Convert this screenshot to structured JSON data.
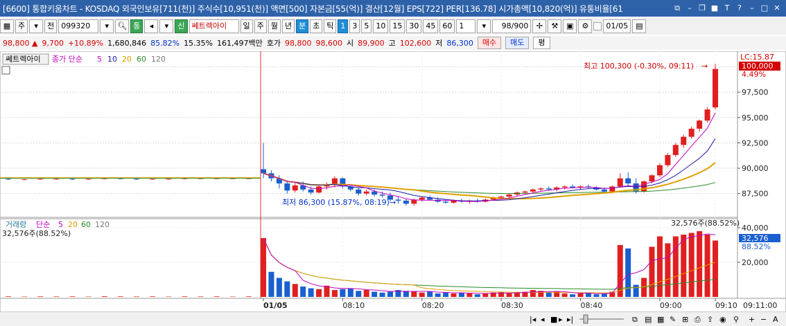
{
  "titlebar": {
    "text": "[6600] 통합키움차트 - KOSDAQ 외국인보유[711(천)] 주식수[10,951(천)] 액면[500] 자본금[55(억)] 결산[12월] EPS[722] PER[136.78] 시가총액[10,820(억)] 유통비율[61",
    "buttons": [
      "⧉",
      "–",
      "❐",
      "■",
      "T",
      "?",
      "–",
      "□",
      "✕"
    ]
  },
  "toolbar": {
    "market_label": "주",
    "all_label": "전",
    "code": "099320",
    "stock_name": "쎄트렉아이",
    "shin_label": "신",
    "periods": [
      "일",
      "주",
      "월",
      "년",
      "분",
      "초",
      "틱"
    ],
    "selected_period": "분",
    "intervals": [
      "1",
      "3",
      "5",
      "10",
      "15",
      "30",
      "45",
      "60"
    ],
    "selected_interval": "1",
    "multiplier": "1",
    "count": "98/900",
    "date": "01/05",
    "tong_label": "통"
  },
  "quote": {
    "price": "98,800 ▲",
    "change": "9,700",
    "change_pct": "+10.89%",
    "volume": "1,680,846",
    "vol_ratio": "85.82%",
    "turnover": "15.35%",
    "amount": "161,497백만",
    "hoga_label": "호가",
    "ask": "98,800",
    "bid": "98,600",
    "open_label": "시",
    "open": "89,900",
    "high_label": "고",
    "high": "102,600",
    "low_label": "저",
    "low": "86,300",
    "buy_label": "매수",
    "sell_label": "매도",
    "pyeong_label": "평"
  },
  "price_panel": {
    "stock_label": "쎄트렉아이",
    "ma_title": "종가 단순",
    "ma_periods": [
      "5",
      "10",
      "20",
      "60",
      "120"
    ],
    "ma_colors": [
      "#c000c0",
      "#1a1aa0",
      "#e0a000",
      "#2a8a2a",
      "#777777"
    ],
    "high_annotation": "최고 100,300 (-0.30%, 09:11)",
    "low_annotation": "최저 86,300 (15.87%, 08:19)",
    "lc_label": "LC:15.87",
    "current_price_label": "100,000",
    "current_pct_label": "4.49%"
  },
  "volume_panel": {
    "title": "거래량",
    "ma_title": "단순",
    "ma_periods": [
      "5",
      "20",
      "60",
      "120"
    ],
    "ma_colors": [
      "#c000c0",
      "#e0a000",
      "#2a8a2a",
      "#777777"
    ],
    "cursor_readout": "32,576주(88.52%)",
    "right_readout": "32,576주(88.52%)",
    "current_label": "32,576",
    "current_pct": "88.52%"
  },
  "footer": {
    "time_label": "09:11:00"
  },
  "chart_data": [
    {
      "type": "candlestick",
      "title": "쎄트렉아이 1분봉",
      "x_labels": [
        "01/05",
        "08:10",
        "08:20",
        "08:30",
        "08:40",
        "09:00",
        "09:10"
      ],
      "y_ticks": [
        87500,
        90000,
        92500,
        95000,
        97500,
        100000
      ],
      "ylim": [
        85700,
        101000
      ],
      "prev_day": [
        [
          88950,
          89000,
          88850,
          88900
        ],
        [
          88900,
          88950,
          88850,
          88900
        ],
        [
          88900,
          88950,
          88850,
          88950
        ],
        [
          88950,
          89000,
          88900,
          88950
        ],
        [
          88950,
          89000,
          88850,
          88900
        ],
        [
          88900,
          88950,
          88850,
          88950
        ],
        [
          88950,
          89050,
          88900,
          89000
        ],
        [
          89000,
          89050,
          88900,
          88950
        ],
        [
          88950,
          89000,
          88850,
          88900
        ],
        [
          88900,
          88950,
          88850,
          88950
        ],
        [
          88950,
          89000,
          88900,
          88950
        ],
        [
          88950,
          89050,
          88900,
          89000
        ],
        [
          89000,
          89050,
          88950,
          89000
        ],
        [
          89000,
          89050,
          88950,
          89000
        ],
        [
          89000,
          89050,
          88950,
          89000
        ],
        [
          89000,
          89050,
          88950,
          89000
        ]
      ],
      "intraday": [
        [
          89900,
          92500,
          89000,
          89500
        ],
        [
          89500,
          89800,
          88700,
          89000
        ],
        [
          89000,
          89300,
          88000,
          88500
        ],
        [
          88500,
          88800,
          87500,
          87800
        ],
        [
          87800,
          88600,
          87600,
          88300
        ],
        [
          88300,
          88700,
          87700,
          87900
        ],
        [
          87900,
          88200,
          87400,
          87600
        ],
        [
          87600,
          88300,
          87500,
          88200
        ],
        [
          88200,
          88600,
          87900,
          88400
        ],
        [
          88400,
          89200,
          88100,
          89000
        ],
        [
          89000,
          89100,
          88000,
          88200
        ],
        [
          88200,
          88400,
          87700,
          87900
        ],
        [
          87900,
          88100,
          87300,
          87500
        ],
        [
          87500,
          87900,
          87300,
          87700
        ],
        [
          87700,
          87900,
          87200,
          87400
        ],
        [
          87400,
          87700,
          87100,
          87300
        ],
        [
          87300,
          87600,
          86700,
          86900
        ],
        [
          86900,
          87200,
          86500,
          86800
        ],
        [
          86800,
          87000,
          86300,
          86500
        ],
        [
          86500,
          87000,
          86300,
          86900
        ],
        [
          86900,
          87200,
          86700,
          87100
        ],
        [
          87100,
          87300,
          86800,
          86900
        ],
        [
          86900,
          87100,
          86600,
          86700
        ],
        [
          86700,
          86900,
          86500,
          86600
        ],
        [
          86600,
          86900,
          86500,
          86800
        ],
        [
          86800,
          87000,
          86600,
          86700
        ],
        [
          86700,
          86900,
          86500,
          86800
        ],
        [
          86800,
          87000,
          86600,
          86700
        ],
        [
          86700,
          87000,
          86600,
          86900
        ],
        [
          86900,
          87200,
          86800,
          87100
        ],
        [
          87100,
          87300,
          86900,
          87200
        ],
        [
          87200,
          87500,
          87000,
          87400
        ],
        [
          87400,
          87700,
          87200,
          87600
        ],
        [
          87600,
          87800,
          87400,
          87700
        ],
        [
          87700,
          88000,
          87500,
          87900
        ],
        [
          87900,
          88100,
          87700,
          88000
        ],
        [
          88000,
          88200,
          87800,
          87900
        ],
        [
          87900,
          88200,
          87700,
          88100
        ],
        [
          88100,
          88300,
          87900,
          88200
        ],
        [
          88200,
          88400,
          88000,
          88100
        ],
        [
          88100,
          88300,
          87900,
          88200
        ],
        [
          88200,
          88400,
          88000,
          88100
        ],
        [
          88100,
          88200,
          87800,
          87900
        ],
        [
          87900,
          88100,
          87600,
          87700
        ],
        [
          87700,
          88300,
          87600,
          88200
        ],
        [
          88200,
          89500,
          88100,
          89000
        ],
        [
          89000,
          89600,
          88200,
          88500
        ],
        [
          88500,
          89000,
          87500,
          87700
        ],
        [
          87700,
          88800,
          87600,
          88700
        ],
        [
          88700,
          89400,
          88500,
          89300
        ],
        [
          89300,
          90500,
          89100,
          90300
        ],
        [
          90300,
          91500,
          90100,
          91300
        ],
        [
          91300,
          92500,
          91100,
          92300
        ],
        [
          92300,
          93300,
          92000,
          93100
        ],
        [
          93100,
          94100,
          92900,
          93900
        ],
        [
          93900,
          94800,
          93600,
          94700
        ],
        [
          94700,
          96000,
          94500,
          95800
        ],
        [
          96000,
          100300,
          95800,
          99800
        ]
      ],
      "ma5_color": "#c000c0",
      "ma20_color": "#e0a000"
    },
    {
      "type": "bar",
      "title": "거래량",
      "y_ticks": [
        20000,
        40000
      ],
      "ylim": [
        0,
        42000
      ],
      "prev_day_volume": [
        300,
        200,
        300,
        250,
        300,
        200,
        350,
        300,
        250,
        300,
        200,
        300,
        250,
        300,
        200,
        300
      ],
      "intraday_volume": [
        34000,
        14500,
        11000,
        9000,
        7500,
        6000,
        5000,
        4500,
        6500,
        4000,
        4500,
        5000,
        3500,
        4000,
        3000,
        2500,
        3000,
        4000,
        3500,
        3000,
        2500,
        3000,
        2000,
        2500,
        2000,
        2500,
        2000,
        1500,
        2000,
        2500,
        3000,
        2000,
        2500,
        3000,
        4000,
        3500,
        2500,
        3000,
        2000,
        1500,
        2000,
        2500,
        1500,
        2000,
        3000,
        30000,
        28000,
        7000,
        11000,
        29000,
        35000,
        31000,
        35000,
        36000,
        37000,
        38000,
        36000,
        32576
      ],
      "intraday_up": [
        true,
        false,
        false,
        false,
        true,
        false,
        false,
        true,
        true,
        true,
        false,
        false,
        false,
        true,
        false,
        false,
        false,
        false,
        false,
        true,
        true,
        false,
        false,
        false,
        true,
        false,
        true,
        false,
        true,
        true,
        true,
        true,
        true,
        true,
        true,
        true,
        false,
        true,
        true,
        false,
        true,
        false,
        false,
        false,
        true,
        true,
        false,
        false,
        true,
        true,
        true,
        true,
        true,
        true,
        true,
        true,
        true,
        true
      ]
    }
  ]
}
